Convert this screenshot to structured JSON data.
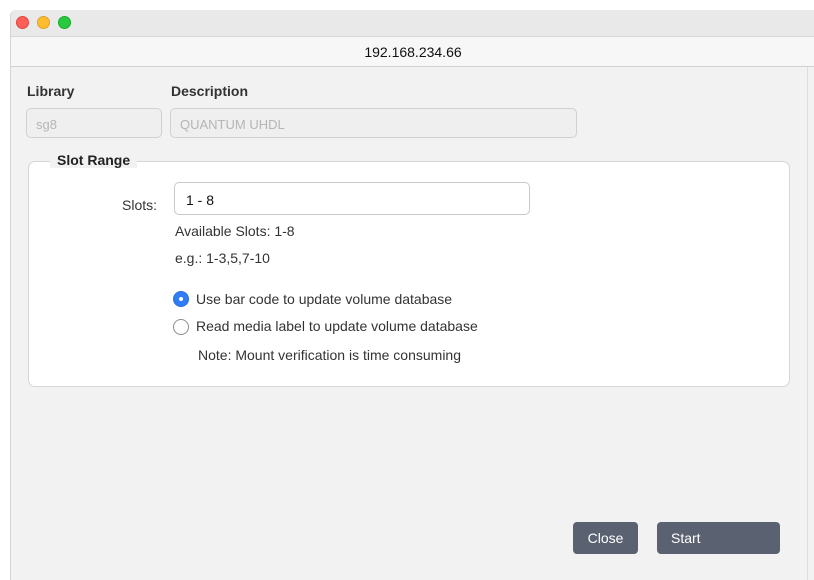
{
  "window": {
    "title": "192.168.234.66"
  },
  "library": {
    "label": "Library",
    "value": "sg8"
  },
  "description": {
    "label": "Description",
    "value": "QUANTUM UHDL"
  },
  "slot_range": {
    "legend": "Slot Range",
    "slots_label": "Slots:",
    "slots_value": "1 - 8",
    "available": "Available Slots: 1-8",
    "example": "e.g.: 1-3,5,7-10"
  },
  "options": {
    "barcode_label": "Use bar code to update volume database",
    "barcode_selected": true,
    "media_label": "Read media label to update volume database",
    "media_selected": false,
    "note": "Note: Mount verification is time consuming"
  },
  "buttons": {
    "close": "Close",
    "start": "Start"
  }
}
